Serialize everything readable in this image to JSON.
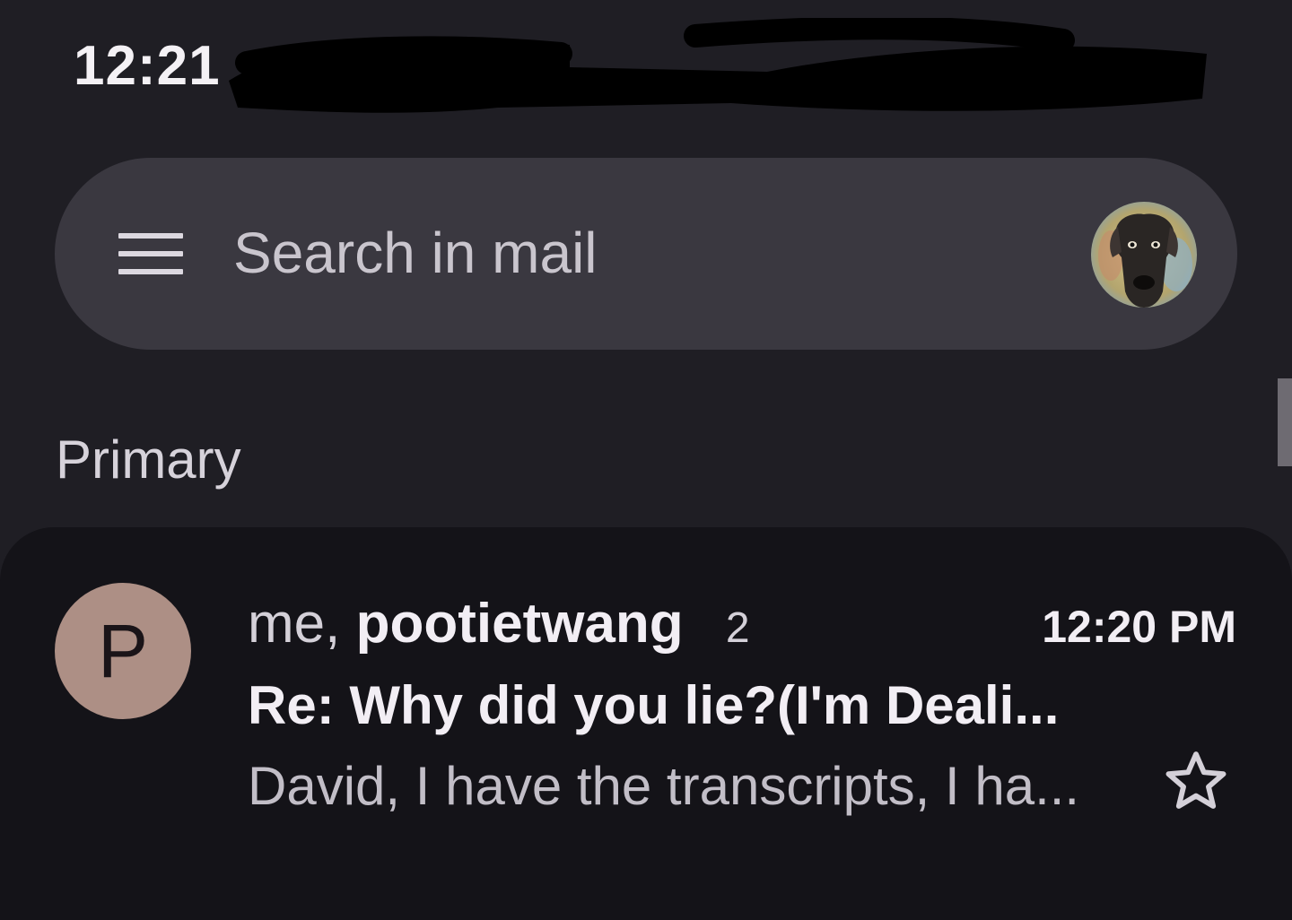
{
  "status_bar": {
    "time": "12:21"
  },
  "search": {
    "placeholder": "Search in mail",
    "menu_icon": "hamburger-menu-icon",
    "avatar": "profile-avatar-dog"
  },
  "inbox": {
    "category_label": "Primary"
  },
  "emails": [
    {
      "avatar_letter": "P",
      "avatar_color": "#ad8f85",
      "sender_prefix": "me,",
      "sender_name": "pootietwang",
      "thread_count": "2",
      "time": "12:20 PM",
      "subject": "Re: Why did you lie?(I'm Deali...",
      "snippet": "David, I have the transcripts, I ha...",
      "starred": false
    }
  ],
  "colors": {
    "background": "#1f1e24",
    "search_bar": "#3a3840",
    "card": "#141318"
  }
}
